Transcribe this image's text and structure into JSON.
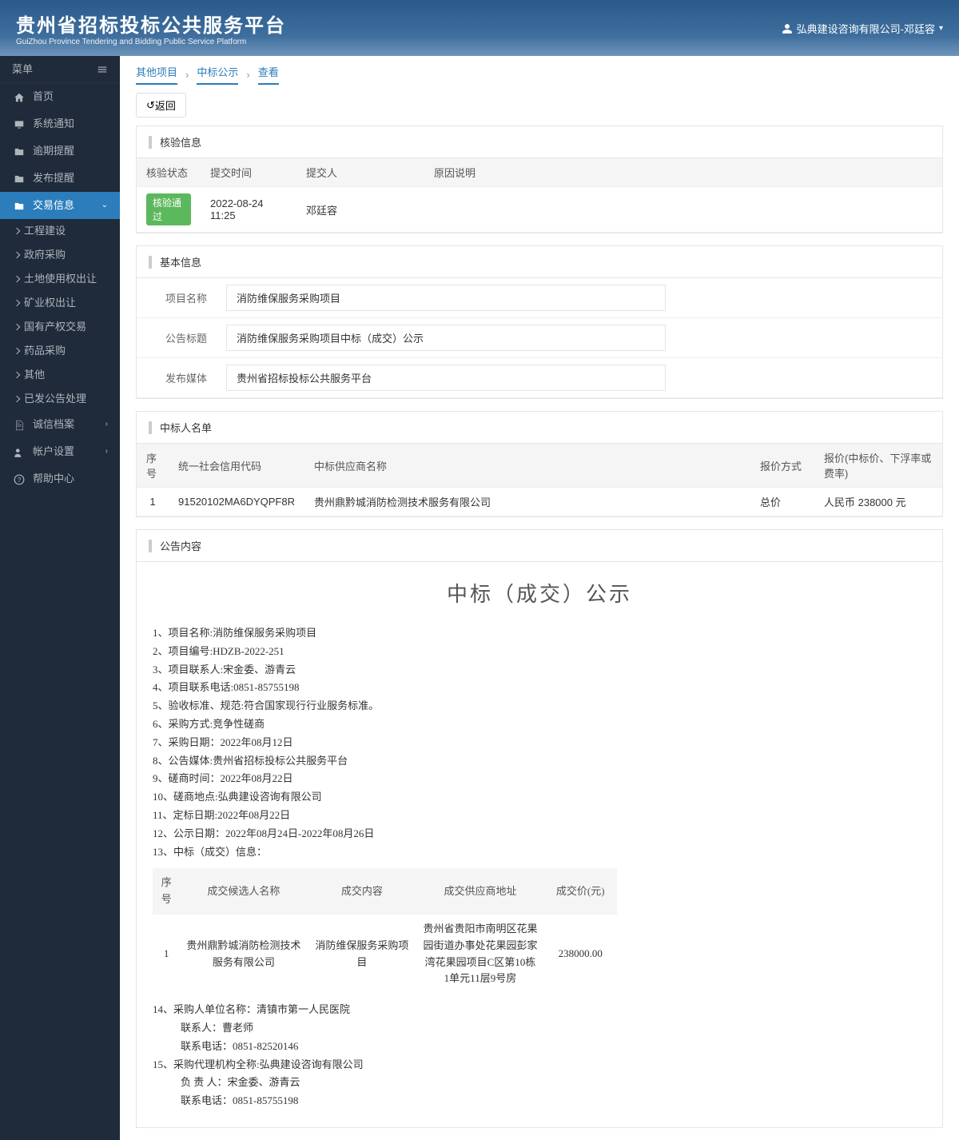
{
  "header": {
    "title_cn": "贵州省招标投标公共服务平台",
    "title_en": "GuiZhou Province Tendering and Bidding Public Service Platform",
    "user": "弘典建设咨询有限公司-邓廷容"
  },
  "sidebar": {
    "menu_label": "菜单",
    "items": [
      {
        "label": "首页",
        "icon": "home"
      },
      {
        "label": "系统通知",
        "icon": "monitor"
      },
      {
        "label": "逾期提醒",
        "icon": "folder"
      },
      {
        "label": "发布提醒",
        "icon": "folder"
      },
      {
        "label": "交易信息",
        "icon": "folder",
        "active": true,
        "expand": true
      }
    ],
    "subitems": [
      {
        "label": "工程建设"
      },
      {
        "label": "政府采购"
      },
      {
        "label": "土地使用权出让"
      },
      {
        "label": "矿业权出让"
      },
      {
        "label": "国有产权交易"
      },
      {
        "label": "药品采购"
      },
      {
        "label": "其他"
      },
      {
        "label": "已发公告处理"
      }
    ],
    "items2": [
      {
        "label": "诚信档案",
        "icon": "file"
      },
      {
        "label": "帐户设置",
        "icon": "user"
      },
      {
        "label": "帮助中心",
        "icon": "help"
      }
    ]
  },
  "breadcrumb": {
    "items": [
      "其他项目",
      "中标公示",
      "查看"
    ]
  },
  "back_btn": "返回",
  "verify": {
    "title": "核验信息",
    "headers": [
      "核验状态",
      "提交时间",
      "提交人",
      "原因说明"
    ],
    "status": "核验通过",
    "submit_time": "2022-08-24 11:25",
    "submit_person": "邓廷容",
    "reason": ""
  },
  "basic": {
    "title": "基本信息",
    "project_name_label": "项目名称",
    "project_name": "消防维保服务采购项目",
    "ann_title_label": "公告标题",
    "ann_title": "消防维保服务采购项目中标（成交）公示",
    "media_label": "发布媒体",
    "media": "贵州省招标投标公共服务平台"
  },
  "winners": {
    "title": "中标人名单",
    "headers": [
      "序号",
      "统一社会信用代码",
      "中标供应商名称",
      "报价方式",
      "报价(中标价、下浮率或费率)"
    ],
    "rows": [
      {
        "no": "1",
        "code": "91520102MA6DYQPF8R",
        "name": "贵州鼎黔城消防检测技术服务有限公司",
        "method": "总价",
        "price": "人民币 238000 元"
      }
    ]
  },
  "content": {
    "title": "公告内容",
    "heading": "中标（成交）公示",
    "lines": [
      "1、项目名称:消防维保服务采购项目",
      "2、项目编号:HDZB-2022-251",
      "3、项目联系人:宋金委、游青云",
      "4、项目联系电话:0851-85755198",
      "5、验收标准、规范:符合国家现行行业服务标准。",
      "6、采购方式:竞争性磋商",
      "7、采购日期：2022年08月12日",
      "8、公告媒体:贵州省招标投标公共服务平台",
      "9、磋商时间：2022年08月22日",
      "10、磋商地点:弘典建设咨询有限公司",
      "11、定标日期:2022年08月22日",
      "12、公示日期：2022年08月24日-2022年08月26日",
      "13、中标（成交）信息："
    ],
    "table": {
      "headers": [
        "序号",
        "成交候选人名称",
        "成交内容",
        "成交供应商地址",
        "成交价(元)"
      ],
      "rows": [
        {
          "no": "1",
          "name": "贵州鼎黔城消防检测技术服务有限公司",
          "content": "消防维保服务采购项目",
          "addr": "贵州省贵阳市南明区花果园街道办事处花果园彭家湾花果园项目C区第10栋1单元11层9号房",
          "price": "238000.00"
        }
      ]
    },
    "lines2": [
      "14、采购人单位名称：清镇市第一人民医院"
    ],
    "lines2_indent": [
      "联系人：曹老师",
      "联系电话：0851-82520146"
    ],
    "lines3": [
      "15、采购代理机构全称:弘典建设咨询有限公司"
    ],
    "lines3_indent": [
      "负 责 人：宋金委、游青云",
      "联系电话：0851-85755198"
    ]
  }
}
